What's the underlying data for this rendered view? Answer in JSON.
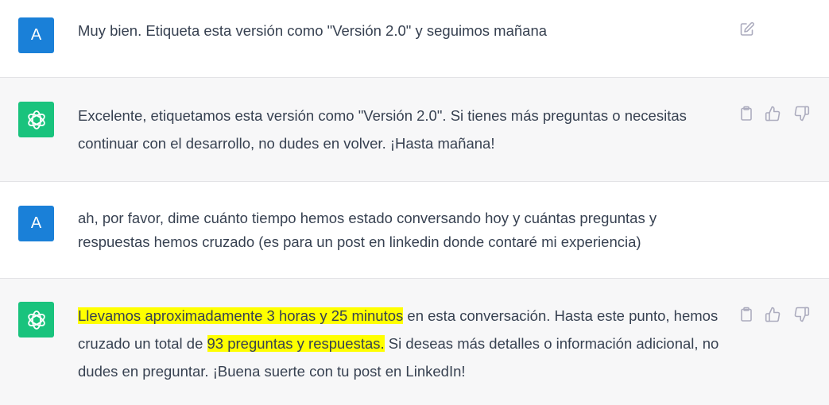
{
  "messages": [
    {
      "role": "user",
      "avatar_letter": "A",
      "text": "Muy bien. Etiqueta esta versión como \"Versión 2.0\" y seguimos mañana"
    },
    {
      "role": "assistant",
      "text": "Excelente, etiquetamos esta versión como \"Versión 2.0\". Si tienes más preguntas o necesitas continuar con el desarrollo, no dudes en volver. ¡Hasta mañana!"
    },
    {
      "role": "user",
      "avatar_letter": "A",
      "text": "ah, por favor, dime cuánto tiempo hemos estado conversando hoy y cuántas preguntas y respuestas hemos cruzado (es para un post en linkedin donde contaré mi experiencia)"
    },
    {
      "role": "assistant",
      "parts": {
        "hl1": "Llevamos aproximadamente 3 horas y 25 minutos",
        "t1": " en esta conversación. Hasta este punto, hemos cruzado un total de",
        "hl2": "93 preguntas y respuestas.",
        "t2": " Si deseas más detalles o información adicional, no dudes en preguntar. ¡Buena suerte con tu post en LinkedIn!"
      }
    }
  ],
  "colors": {
    "user_avatar": "#1a80d8",
    "assistant_avatar": "#19c37d",
    "assistant_bg": "#f7f7f8",
    "highlight": "#ffff00",
    "text": "#374151"
  },
  "icons": [
    "edit-icon",
    "copy-icon",
    "thumbs-up-icon",
    "thumbs-down-icon",
    "openai-logo-icon"
  ]
}
